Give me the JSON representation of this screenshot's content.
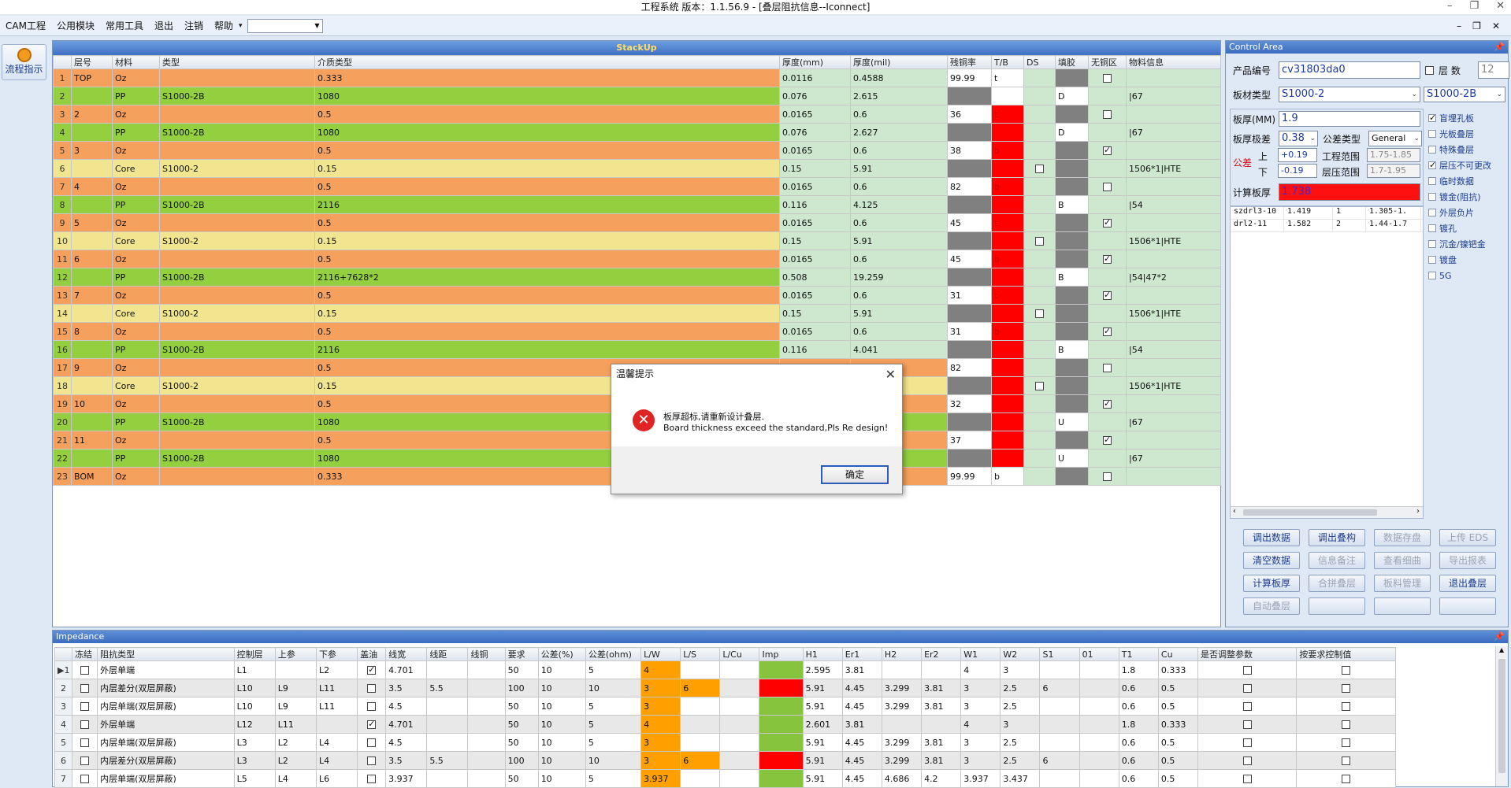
{
  "window": {
    "title": "工程系统  版本：1.1.56.9 - [叠层阻抗信息--Iconnect]"
  },
  "menu": [
    "CAM工程",
    "公用模块",
    "常用工具",
    "退出",
    "注销",
    "帮助"
  ],
  "help_arrow": "▾",
  "left": {
    "flow_label": "流程指示"
  },
  "stackup": {
    "title": "StackUp",
    "headers": [
      "层号",
      "材料",
      "类型",
      "介质类型",
      "厚度(mm)",
      "厚度(mil)",
      "残铜率",
      "T/B",
      "DS",
      "填胶",
      "无铜区",
      "物料信息"
    ],
    "rows": [
      {
        "n": "1",
        "layer": "TOP",
        "mat": "Oz",
        "type": "",
        "diel": "0.333",
        "mm": "0.0116",
        "mil": "0.4588",
        "cu": "99.99",
        "tb": "t",
        "ds": "",
        "fill": "",
        "nocu": false,
        "info": "",
        "kind": "oz"
      },
      {
        "n": "2",
        "layer": "",
        "mat": "PP",
        "type": "S1000-2B",
        "diel": "1080",
        "mm": "0.076",
        "mil": "2.615",
        "cu": "",
        "tb": "",
        "ds": "",
        "fill": "D",
        "nocu": null,
        "info": "|67",
        "kind": "pp"
      },
      {
        "n": "3",
        "layer": "2",
        "mat": "Oz",
        "type": "",
        "diel": "0.5",
        "mm": "0.0165",
        "mil": "0.6",
        "cu": "36",
        "tb": "t",
        "ds": "",
        "fill": "",
        "nocu": false,
        "info": "",
        "kind": "oz"
      },
      {
        "n": "4",
        "layer": "",
        "mat": "PP",
        "type": "S1000-2B",
        "diel": "1080",
        "mm": "0.076",
        "mil": "2.627",
        "cu": "",
        "tb": "",
        "ds": "",
        "fill": "D",
        "nocu": null,
        "info": "|67",
        "kind": "pp"
      },
      {
        "n": "5",
        "layer": "3",
        "mat": "Oz",
        "type": "",
        "diel": "0.5",
        "mm": "0.0165",
        "mil": "0.6",
        "cu": "38",
        "tb": "b",
        "ds": "",
        "fill": "",
        "nocu": true,
        "info": "",
        "kind": "oz"
      },
      {
        "n": "6",
        "layer": "",
        "mat": "Core",
        "type": "S1000-2",
        "diel": "0.15",
        "mm": "0.15",
        "mil": "5.91",
        "cu": "",
        "tb": "",
        "ds": "box",
        "fill": "",
        "nocu": null,
        "info": "1506*1|HTE",
        "kind": "core"
      },
      {
        "n": "7",
        "layer": "4",
        "mat": "Oz",
        "type": "",
        "diel": "0.5",
        "mm": "0.0165",
        "mil": "0.6",
        "cu": "82",
        "tb": "b",
        "ds": "",
        "fill": "",
        "nocu": false,
        "info": "",
        "kind": "oz"
      },
      {
        "n": "8",
        "layer": "",
        "mat": "PP",
        "type": "S1000-2B",
        "diel": "2116",
        "mm": "0.116",
        "mil": "4.125",
        "cu": "",
        "tb": "",
        "ds": "",
        "fill": "B",
        "nocu": null,
        "info": "|54",
        "kind": "pp"
      },
      {
        "n": "9",
        "layer": "5",
        "mat": "Oz",
        "type": "",
        "diel": "0.5",
        "mm": "0.0165",
        "mil": "0.6",
        "cu": "45",
        "tb": "t",
        "ds": "",
        "fill": "",
        "nocu": true,
        "info": "",
        "kind": "oz"
      },
      {
        "n": "10",
        "layer": "",
        "mat": "Core",
        "type": "S1000-2",
        "diel": "0.15",
        "mm": "0.15",
        "mil": "5.91",
        "cu": "",
        "tb": "",
        "ds": "box",
        "fill": "",
        "nocu": null,
        "info": "1506*1|HTE",
        "kind": "core"
      },
      {
        "n": "11",
        "layer": "6",
        "mat": "Oz",
        "type": "",
        "diel": "0.5",
        "mm": "0.0165",
        "mil": "0.6",
        "cu": "45",
        "tb": "b",
        "ds": "",
        "fill": "",
        "nocu": true,
        "info": "",
        "kind": "oz"
      },
      {
        "n": "12",
        "layer": "",
        "mat": "PP",
        "type": "S1000-2B",
        "diel": "2116+7628*2",
        "mm": "0.508",
        "mil": "19.259",
        "cu": "",
        "tb": "",
        "ds": "",
        "fill": "B",
        "nocu": null,
        "info": "|54|47*2",
        "kind": "pp"
      },
      {
        "n": "13",
        "layer": "7",
        "mat": "Oz",
        "type": "",
        "diel": "0.5",
        "mm": "0.0165",
        "mil": "0.6",
        "cu": "31",
        "tb": "t",
        "ds": "",
        "fill": "",
        "nocu": true,
        "info": "",
        "kind": "oz"
      },
      {
        "n": "14",
        "layer": "",
        "mat": "Core",
        "type": "S1000-2",
        "diel": "0.15",
        "mm": "0.15",
        "mil": "5.91",
        "cu": "",
        "tb": "",
        "ds": "box",
        "fill": "",
        "nocu": null,
        "info": "1506*1|HTE",
        "kind": "core"
      },
      {
        "n": "15",
        "layer": "8",
        "mat": "Oz",
        "type": "",
        "diel": "0.5",
        "mm": "0.0165",
        "mil": "0.6",
        "cu": "31",
        "tb": "b",
        "ds": "",
        "fill": "",
        "nocu": true,
        "info": "",
        "kind": "oz"
      },
      {
        "n": "16",
        "layer": "",
        "mat": "PP",
        "type": "S1000-2B",
        "diel": "2116",
        "mm": "0.116",
        "mil": "4.041",
        "cu": "",
        "tb": "",
        "ds": "",
        "fill": "B",
        "nocu": null,
        "info": "|54",
        "kind": "pp"
      },
      {
        "n": "17",
        "layer": "9",
        "mat": "Oz",
        "type": "",
        "diel": "0.5",
        "mm": "",
        "mil": "",
        "cu": "82",
        "tb": "",
        "ds": "",
        "fill": "",
        "nocu": false,
        "info": "",
        "kind": "oz"
      },
      {
        "n": "18",
        "layer": "",
        "mat": "Core",
        "type": "S1000-2",
        "diel": "0.15",
        "mm": "",
        "mil": "",
        "cu": "",
        "tb": "",
        "ds": "box",
        "fill": "",
        "nocu": null,
        "info": "1506*1|HTE",
        "kind": "core"
      },
      {
        "n": "19",
        "layer": "10",
        "mat": "Oz",
        "type": "",
        "diel": "0.5",
        "mm": "",
        "mil": "",
        "cu": "32",
        "tb": "",
        "ds": "",
        "fill": "",
        "nocu": true,
        "info": "",
        "kind": "oz"
      },
      {
        "n": "20",
        "layer": "",
        "mat": "PP",
        "type": "S1000-2B",
        "diel": "1080",
        "mm": "",
        "mil": "",
        "cu": "",
        "tb": "",
        "ds": "",
        "fill": "U",
        "nocu": null,
        "info": "|67",
        "kind": "pp"
      },
      {
        "n": "21",
        "layer": "11",
        "mat": "Oz",
        "type": "",
        "diel": "0.5",
        "mm": "",
        "mil": "",
        "cu": "37",
        "tb": "",
        "ds": "",
        "fill": "",
        "nocu": true,
        "info": "",
        "kind": "oz"
      },
      {
        "n": "22",
        "layer": "",
        "mat": "PP",
        "type": "S1000-2B",
        "diel": "1080",
        "mm": "",
        "mil": "",
        "cu": "",
        "tb": "",
        "ds": "",
        "fill": "U",
        "nocu": null,
        "info": "|67",
        "kind": "pp"
      },
      {
        "n": "23",
        "layer": "BOM",
        "mat": "Oz",
        "type": "",
        "diel": "0.333",
        "mm": "",
        "mil": "",
        "cu": "99.99",
        "tb": "b",
        "ds": "",
        "fill": "",
        "nocu": false,
        "info": "",
        "kind": "oz"
      }
    ]
  },
  "control": {
    "title": "Control Area",
    "product_label": "产品编号",
    "product_value": "cv31803da0",
    "layers_label": "层 数",
    "layers_value": "12",
    "board_type_label": "板材类型",
    "board_type_value": "S1000-2",
    "board_type_value2": "S1000-2B",
    "thickness_label": "板厚(MM)",
    "thickness_value": "1.9",
    "extreme_label": "板厚极差",
    "extreme_value": "0.38",
    "tol_type_label": "公差类型",
    "tol_type_value": "General",
    "tol_label": "公差",
    "up_label": "上",
    "down_label": "下",
    "up_value": "+0.19",
    "down_value": "-0.19",
    "eng_range_label": "工程范围",
    "eng_range_value": "1.75-1.85",
    "press_range_label": "层压范围",
    "press_range_value": "1.7-1.95",
    "calc_label": "计算板厚",
    "calc_value": "1.738",
    "list_rows": [
      [
        "szdrl3-10",
        "1.419",
        "1",
        "1.305-1."
      ],
      [
        "drl2-11",
        "1.582",
        "2",
        "1.44-1.7"
      ]
    ],
    "checkboxes": [
      {
        "label": "盲埋孔板",
        "checked": true
      },
      {
        "label": "光板叠层",
        "checked": false
      },
      {
        "label": "特殊叠层",
        "checked": false
      },
      {
        "label": "层压不可更改",
        "checked": true
      },
      {
        "label": "临时数据",
        "checked": false
      },
      {
        "label": "镀金(阻抗)",
        "checked": false
      },
      {
        "label": "外层负片",
        "checked": false
      },
      {
        "label": "镀孔",
        "checked": false
      },
      {
        "label": "沉金/镍钯金",
        "checked": false
      },
      {
        "label": "镀盘",
        "checked": false
      },
      {
        "label": "5G",
        "checked": false
      }
    ],
    "buttons": {
      "call_data": "调出数据",
      "call_stack": "调出叠构",
      "save_data": "数据存盘",
      "upload_eds": "上传 EDS",
      "clear_data": "清空数据",
      "info_note": "信息备注",
      "view_detail": "查看细曲",
      "export_report": "导出报表",
      "calc_thickness": "计算板厚",
      "merge_stack": "合拼叠层",
      "material_mgmt": "板料管理",
      "exit_stack": "退出叠层",
      "auto_stack": "自动叠层"
    }
  },
  "impedance": {
    "title": "Impedance",
    "headers": [
      "",
      "冻结",
      "阻抗类型",
      "控制层",
      "上参",
      "下参",
      "盖油",
      "线宽",
      "线距",
      "线铜",
      "要求",
      "公差(%)",
      "公差(ohm)",
      "L/W",
      "L/S",
      "L/Cu",
      "Imp",
      "H1",
      "Er1",
      "H2",
      "Er2",
      "W1",
      "W2",
      "S1",
      "01",
      "T1",
      "Cu",
      "是否调整参数",
      "按要求控制值"
    ],
    "rows": [
      {
        "n": "▶1",
        "type": "外层单端",
        "ctrl": "L1",
        "up": "",
        "down": "L2",
        "oil": true,
        "w": "4.701",
        "s": "",
        "cu": "",
        "req": "50",
        "tolp": "10",
        "tolo": "5",
        "lw": "4",
        "ls": "",
        "lcu": "",
        "imp": "green",
        "h1": "2.595",
        "er1": "3.81",
        "h2": "",
        "er2": "",
        "w1": "4",
        "w2": "3",
        "s1": "",
        "o1": "",
        "t1": "1.8",
        "cuv": "0.333"
      },
      {
        "n": "2",
        "type": "内层差分(双层屏蔽)",
        "ctrl": "L10",
        "up": "L9",
        "down": "L11",
        "oil": false,
        "w": "3.5",
        "s": "5.5",
        "cu": "",
        "req": "100",
        "tolp": "10",
        "tolo": "10",
        "lw": "3",
        "ls": "6",
        "lcu": "",
        "imp": "red",
        "h1": "5.91",
        "er1": "4.45",
        "h2": "3.299",
        "er2": "3.81",
        "w1": "3",
        "w2": "2.5",
        "s1": "6",
        "o1": "",
        "t1": "0.6",
        "cuv": "0.5"
      },
      {
        "n": "3",
        "type": "内层单端(双层屏蔽)",
        "ctrl": "L10",
        "up": "L9",
        "down": "L11",
        "oil": false,
        "w": "4.5",
        "s": "",
        "cu": "",
        "req": "50",
        "tolp": "10",
        "tolo": "5",
        "lw": "3",
        "ls": "",
        "lcu": "",
        "imp": "green",
        "h1": "5.91",
        "er1": "4.45",
        "h2": "3.299",
        "er2": "3.81",
        "w1": "3",
        "w2": "2.5",
        "s1": "",
        "o1": "",
        "t1": "0.6",
        "cuv": "0.5"
      },
      {
        "n": "4",
        "type": "外层单端",
        "ctrl": "L12",
        "up": "L11",
        "down": "",
        "oil": true,
        "w": "4.701",
        "s": "",
        "cu": "",
        "req": "50",
        "tolp": "10",
        "tolo": "5",
        "lw": "4",
        "ls": "",
        "lcu": "",
        "imp": "green",
        "h1": "2.601",
        "er1": "3.81",
        "h2": "",
        "er2": "",
        "w1": "4",
        "w2": "3",
        "s1": "",
        "o1": "",
        "t1": "1.8",
        "cuv": "0.333"
      },
      {
        "n": "5",
        "type": "内层单端(双层屏蔽)",
        "ctrl": "L3",
        "up": "L2",
        "down": "L4",
        "oil": false,
        "w": "4.5",
        "s": "",
        "cu": "",
        "req": "50",
        "tolp": "10",
        "tolo": "5",
        "lw": "3",
        "ls": "",
        "lcu": "",
        "imp": "green",
        "h1": "5.91",
        "er1": "4.45",
        "h2": "3.299",
        "er2": "3.81",
        "w1": "3",
        "w2": "2.5",
        "s1": "",
        "o1": "",
        "t1": "0.6",
        "cuv": "0.5"
      },
      {
        "n": "6",
        "type": "内层差分(双层屏蔽)",
        "ctrl": "L3",
        "up": "L2",
        "down": "L4",
        "oil": false,
        "w": "3.5",
        "s": "5.5",
        "cu": "",
        "req": "100",
        "tolp": "10",
        "tolo": "10",
        "lw": "3",
        "ls": "6",
        "lcu": "",
        "imp": "red",
        "h1": "5.91",
        "er1": "4.45",
        "h2": "3.299",
        "er2": "3.81",
        "w1": "3",
        "w2": "2.5",
        "s1": "6",
        "o1": "",
        "t1": "0.6",
        "cuv": "0.5"
      },
      {
        "n": "7",
        "type": "内层单端(双层屏蔽)",
        "ctrl": "L5",
        "up": "L4",
        "down": "L6",
        "oil": false,
        "w": "3.937",
        "s": "",
        "cu": "",
        "req": "50",
        "tolp": "10",
        "tolo": "5",
        "lw": "3.937",
        "ls": "",
        "lcu": "",
        "imp": "green",
        "h1": "5.91",
        "er1": "4.45",
        "h2": "4.686",
        "er2": "4.2",
        "w1": "3.937",
        "w2": "3.437",
        "s1": "",
        "o1": "",
        "t1": "0.6",
        "cuv": "0.5"
      }
    ]
  },
  "dialog": {
    "title": "温馨提示",
    "message_cn": "板厚超标,请重新设计叠层.",
    "message_en": "Board thickness exceed the standard,Pls Re design!",
    "ok": "确定"
  }
}
